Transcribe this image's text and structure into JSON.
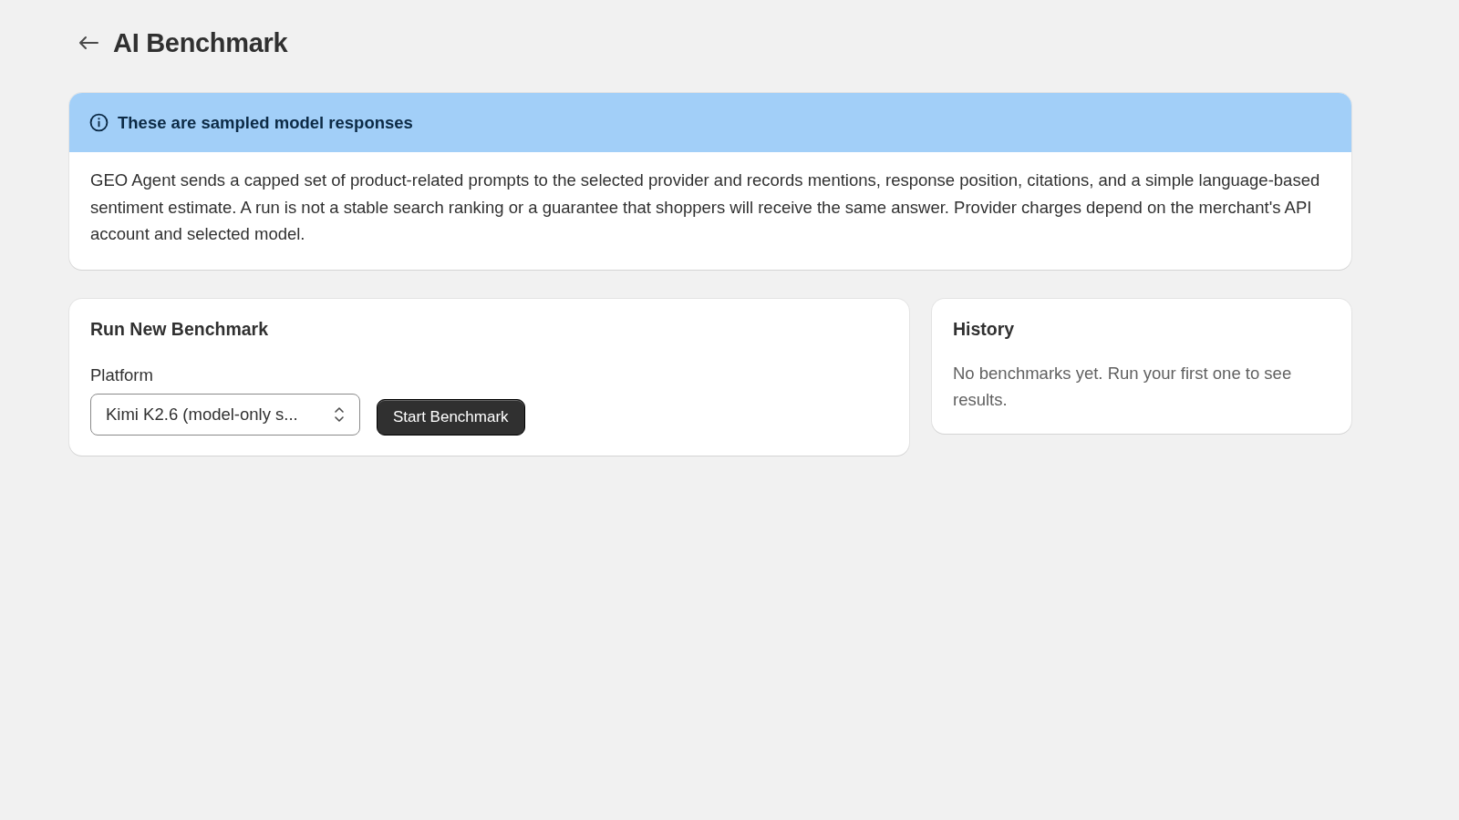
{
  "page": {
    "title": "AI Benchmark"
  },
  "notice": {
    "title": "These are sampled model responses",
    "body": "GEO Agent sends a capped set of product-related prompts to the selected provider and records mentions, response position, citations, and a simple language-based sentiment estimate. A run is not a stable search ranking or a guarantee that shoppers will receive the same answer. Provider charges depend on the merchant's API account and selected model."
  },
  "run_card": {
    "title": "Run New Benchmark",
    "field_label": "Platform",
    "select_value": "Kimi K2.6 (model-only s...",
    "button": "Start Benchmark"
  },
  "history": {
    "title": "History",
    "empty_text": "No benchmarks yet. Run your first one to see results."
  }
}
